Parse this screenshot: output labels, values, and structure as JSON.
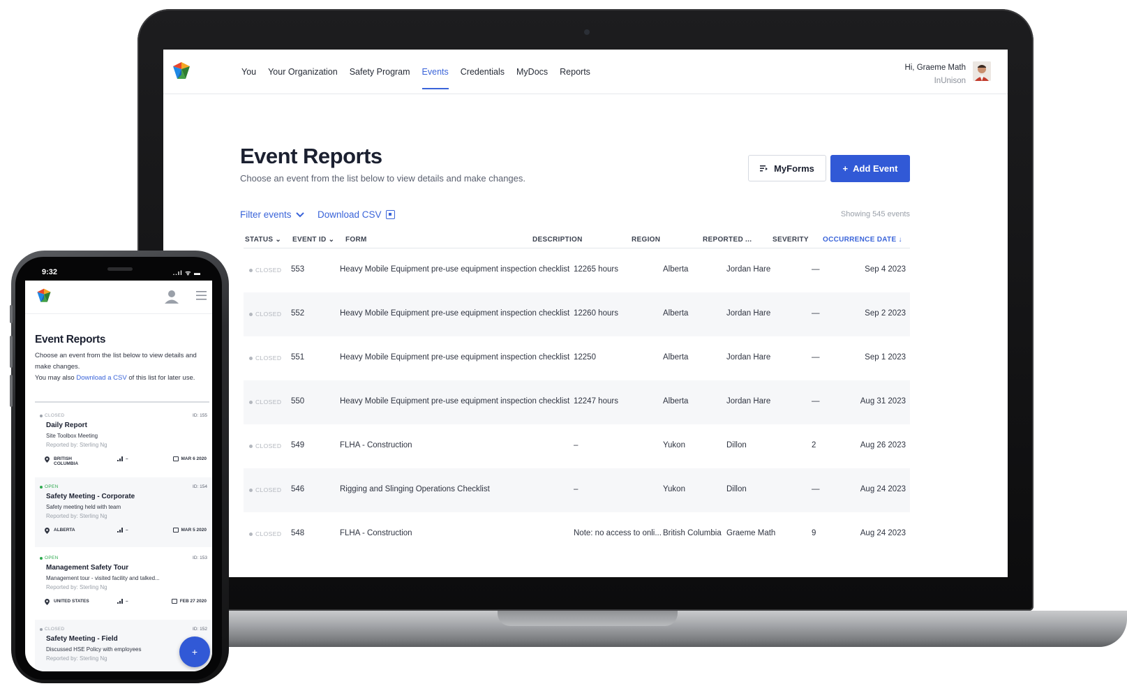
{
  "desktop": {
    "nav": {
      "items": [
        {
          "label": "You"
        },
        {
          "label": "Your Organization"
        },
        {
          "label": "Safety Program"
        },
        {
          "label": "Events",
          "active": true
        },
        {
          "label": "Credentials"
        },
        {
          "label": "MyDocs"
        },
        {
          "label": "Reports"
        }
      ],
      "greeting": "Hi, Graeme Math",
      "org": "InUnison"
    },
    "page": {
      "title": "Event Reports",
      "subtitle": "Choose an event from the list below to view details and make changes."
    },
    "buttons": {
      "myforms": "MyForms",
      "add_event": "Add Event",
      "add_icon": "+"
    },
    "toolbar": {
      "filter": "Filter events",
      "csv": "Download CSV",
      "showing": "Showing 545 events"
    },
    "table": {
      "headers": {
        "status": "STATUS",
        "event_id": "EVENT ID",
        "form": "FORM",
        "description": "DESCRIPTION",
        "region": "REGION",
        "reported": "REPORTED ...",
        "severity": "SEVERITY",
        "occurrence": "OCCURRENCE DATE"
      },
      "sort_arrow": "↓",
      "rows": [
        {
          "status": "CLOSED",
          "id": "553",
          "form": "Heavy Mobile Equipment pre-use equipment inspection checklist",
          "description": "12265 hours",
          "region": "Alberta",
          "reported": "Jordan Hare",
          "severity": "—",
          "date": "Sep 4 2023"
        },
        {
          "status": "CLOSED",
          "id": "552",
          "form": "Heavy Mobile Equipment pre-use equipment inspection checklist",
          "description": "12260 hours",
          "region": "Alberta",
          "reported": "Jordan Hare",
          "severity": "—",
          "date": "Sep 2 2023"
        },
        {
          "status": "CLOSED",
          "id": "551",
          "form": "Heavy Mobile Equipment pre-use equipment inspection checklist",
          "description": "12250",
          "region": "Alberta",
          "reported": "Jordan Hare",
          "severity": "—",
          "date": "Sep 1 2023"
        },
        {
          "status": "CLOSED",
          "id": "550",
          "form": "Heavy Mobile Equipment pre-use equipment inspection checklist",
          "description": "12247 hours",
          "region": "Alberta",
          "reported": "Jordan Hare",
          "severity": "—",
          "date": "Aug 31 2023"
        },
        {
          "status": "CLOSED",
          "id": "549",
          "form": "FLHA - Construction",
          "description": "–",
          "region": "Yukon",
          "reported": "Dillon",
          "severity": "2",
          "date": "Aug 26 2023"
        },
        {
          "status": "CLOSED",
          "id": "546",
          "form": "Rigging and Slinging Operations Checklist",
          "description": "–",
          "region": "Yukon",
          "reported": "Dillon",
          "severity": "—",
          "date": "Aug 24 2023"
        },
        {
          "status": "CLOSED",
          "id": "548",
          "form": "FLHA - Construction",
          "description": "Note: no access to onli...",
          "region": "British Columbia",
          "reported": "Graeme Math",
          "severity": "9",
          "date": "Aug 24 2023"
        }
      ]
    }
  },
  "mobile": {
    "status_bar": {
      "time": "9:32",
      "indicators": "..ıl ᯤ ▬"
    },
    "title": "Event Reports",
    "desc_1": "Choose an event from the list below to view details and make changes.",
    "desc_2a": "You may also ",
    "desc_link": "Download a CSV",
    "desc_2b": " of this list for later use.",
    "fab": "+",
    "cards": [
      {
        "status": "CLOSED",
        "status_color": "#9aa0a9",
        "id": "ID: 155",
        "title": "Daily Report",
        "subtitle": "Site Toolbox Meeting",
        "reported": "Reported by: Sterling Ng",
        "region_1": "BRITISH",
        "region_2": "COLUMBIA",
        "severity": "–",
        "date": "MAR 6 2020"
      },
      {
        "status": "OPEN",
        "status_color": "#2eaa4f",
        "id": "ID: 154",
        "title": "Safety Meeting - Corporate",
        "subtitle": "Safety meeting held with team",
        "reported": "Reported by: Sterling Ng",
        "region_1": "ALBERTA",
        "region_2": "",
        "severity": "–",
        "date": "MAR 5 2020"
      },
      {
        "status": "OPEN",
        "status_color": "#2eaa4f",
        "id": "ID: 153",
        "title": "Management Safety Tour",
        "subtitle": "Management tour - visited facility and talked...",
        "reported": "Reported by: Sterling Ng",
        "region_1": "UNITED STATES",
        "region_2": "",
        "severity": "–",
        "date": "FEB 27 2020"
      },
      {
        "status": "CLOSED",
        "status_color": "#9aa0a9",
        "id": "ID: 152",
        "title": "Safety Meeting - Field",
        "subtitle": "Discussed HSE Policy with employees",
        "reported": "Reported by: Sterling Ng",
        "region_1": "",
        "region_2": "",
        "severity": "",
        "date": ""
      }
    ]
  },
  "colors": {
    "accent": "#3159d6",
    "link": "#3a64d9",
    "open": "#2eaa4f",
    "closed": "#b3b7be"
  },
  "icons": [
    "inunison-logo-icon",
    "myforms-icon",
    "plus-icon",
    "chevron-down-icon",
    "csv-icon",
    "sort-down-icon",
    "user-icon",
    "menu-icon",
    "location-pin-icon",
    "signal-bars-icon",
    "calendar-icon"
  ]
}
